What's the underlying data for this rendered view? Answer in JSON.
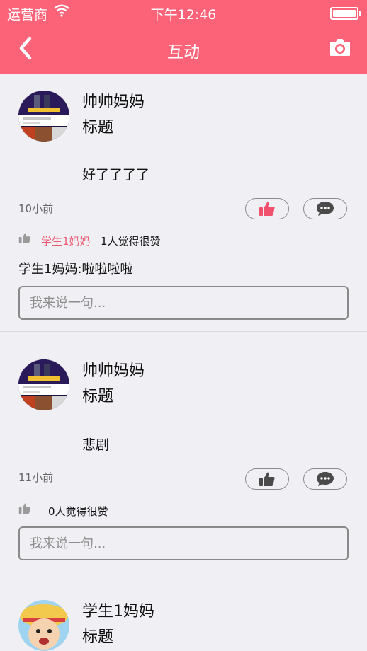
{
  "status_bar": {
    "carrier": "运营商",
    "time": "下午12:46"
  },
  "nav": {
    "title": "互动"
  },
  "colors": {
    "brand": "#fd6378",
    "like_active": "#f0506c",
    "like_inactive": "#4a4a4a"
  },
  "posts": [
    {
      "author": "帅帅妈妈",
      "title": "标题",
      "content": "好了了了了",
      "time": "10小前",
      "liked": true,
      "likers": "学生1妈妈",
      "likes_text": "1人觉得很赞",
      "comments": [
        "学生1妈妈:啦啦啦啦"
      ],
      "comment_placeholder": "我来说一句..."
    },
    {
      "author": "帅帅妈妈",
      "title": "标题",
      "content": "悲剧",
      "time": "11小前",
      "liked": false,
      "likers": "",
      "likes_text": "0人觉得很赞",
      "comments": [],
      "comment_placeholder": "我来说一句..."
    },
    {
      "author": "学生1妈妈",
      "title": "标题"
    }
  ]
}
